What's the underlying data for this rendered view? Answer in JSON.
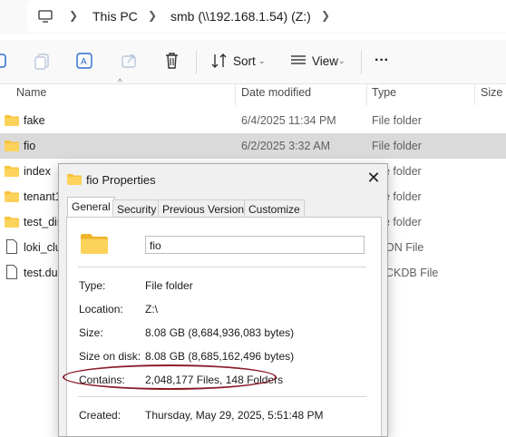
{
  "address": {
    "crumbs": [
      "This PC",
      "smb (\\\\192.168.1.54) (Z:)"
    ]
  },
  "toolbar": {
    "sort_label": "Sort",
    "view_label": "View",
    "more_label": "···"
  },
  "columns": {
    "name": "Name",
    "date_modified": "Date modified",
    "type": "Type",
    "size": "Size"
  },
  "files": [
    {
      "name": "fake",
      "date": "6/4/2025 11:34 PM",
      "type": "File folder",
      "kind": "folder"
    },
    {
      "name": "fio",
      "date": "6/2/2025 3:32 AM",
      "type": "File folder",
      "kind": "folder",
      "selected": true
    },
    {
      "name": "index",
      "date": "",
      "type": "e folder",
      "kind": "folder"
    },
    {
      "name": "tenant1",
      "date": "",
      "type": "e folder",
      "kind": "folder"
    },
    {
      "name": "test_dir",
      "date": "",
      "type": "e folder",
      "kind": "folder"
    },
    {
      "name": "loki_clu",
      "date": "",
      "type": "ON File",
      "kind": "file"
    },
    {
      "name": "test.duc",
      "date": "",
      "type": "CKDB File",
      "kind": "file"
    }
  ],
  "dialog": {
    "title": "fio Properties",
    "close": "✕",
    "tabs": [
      "General",
      "Security",
      "Previous Versions",
      "Customize"
    ],
    "folder_name": "fio",
    "props": {
      "type_label": "Type:",
      "type_value": "File folder",
      "location_label": "Location:",
      "location_value": "Z:\\",
      "size_label": "Size:",
      "size_value": "8.08 GB (8,684,936,083 bytes)",
      "size_on_disk_label": "Size on disk:",
      "size_on_disk_value": "8.08 GB (8,685,162,496 bytes)",
      "contains_label": "Contains:",
      "contains_value": "2,048,177 Files, 148 Folders",
      "created_label": "Created:",
      "created_value": "Thursday, May 29, 2025, 5:51:48 PM"
    }
  },
  "colors": {
    "accent": "#1b1b1b",
    "folder_yellow": "#f8c33a",
    "highlight_ellipse": "#8a1e2b"
  }
}
